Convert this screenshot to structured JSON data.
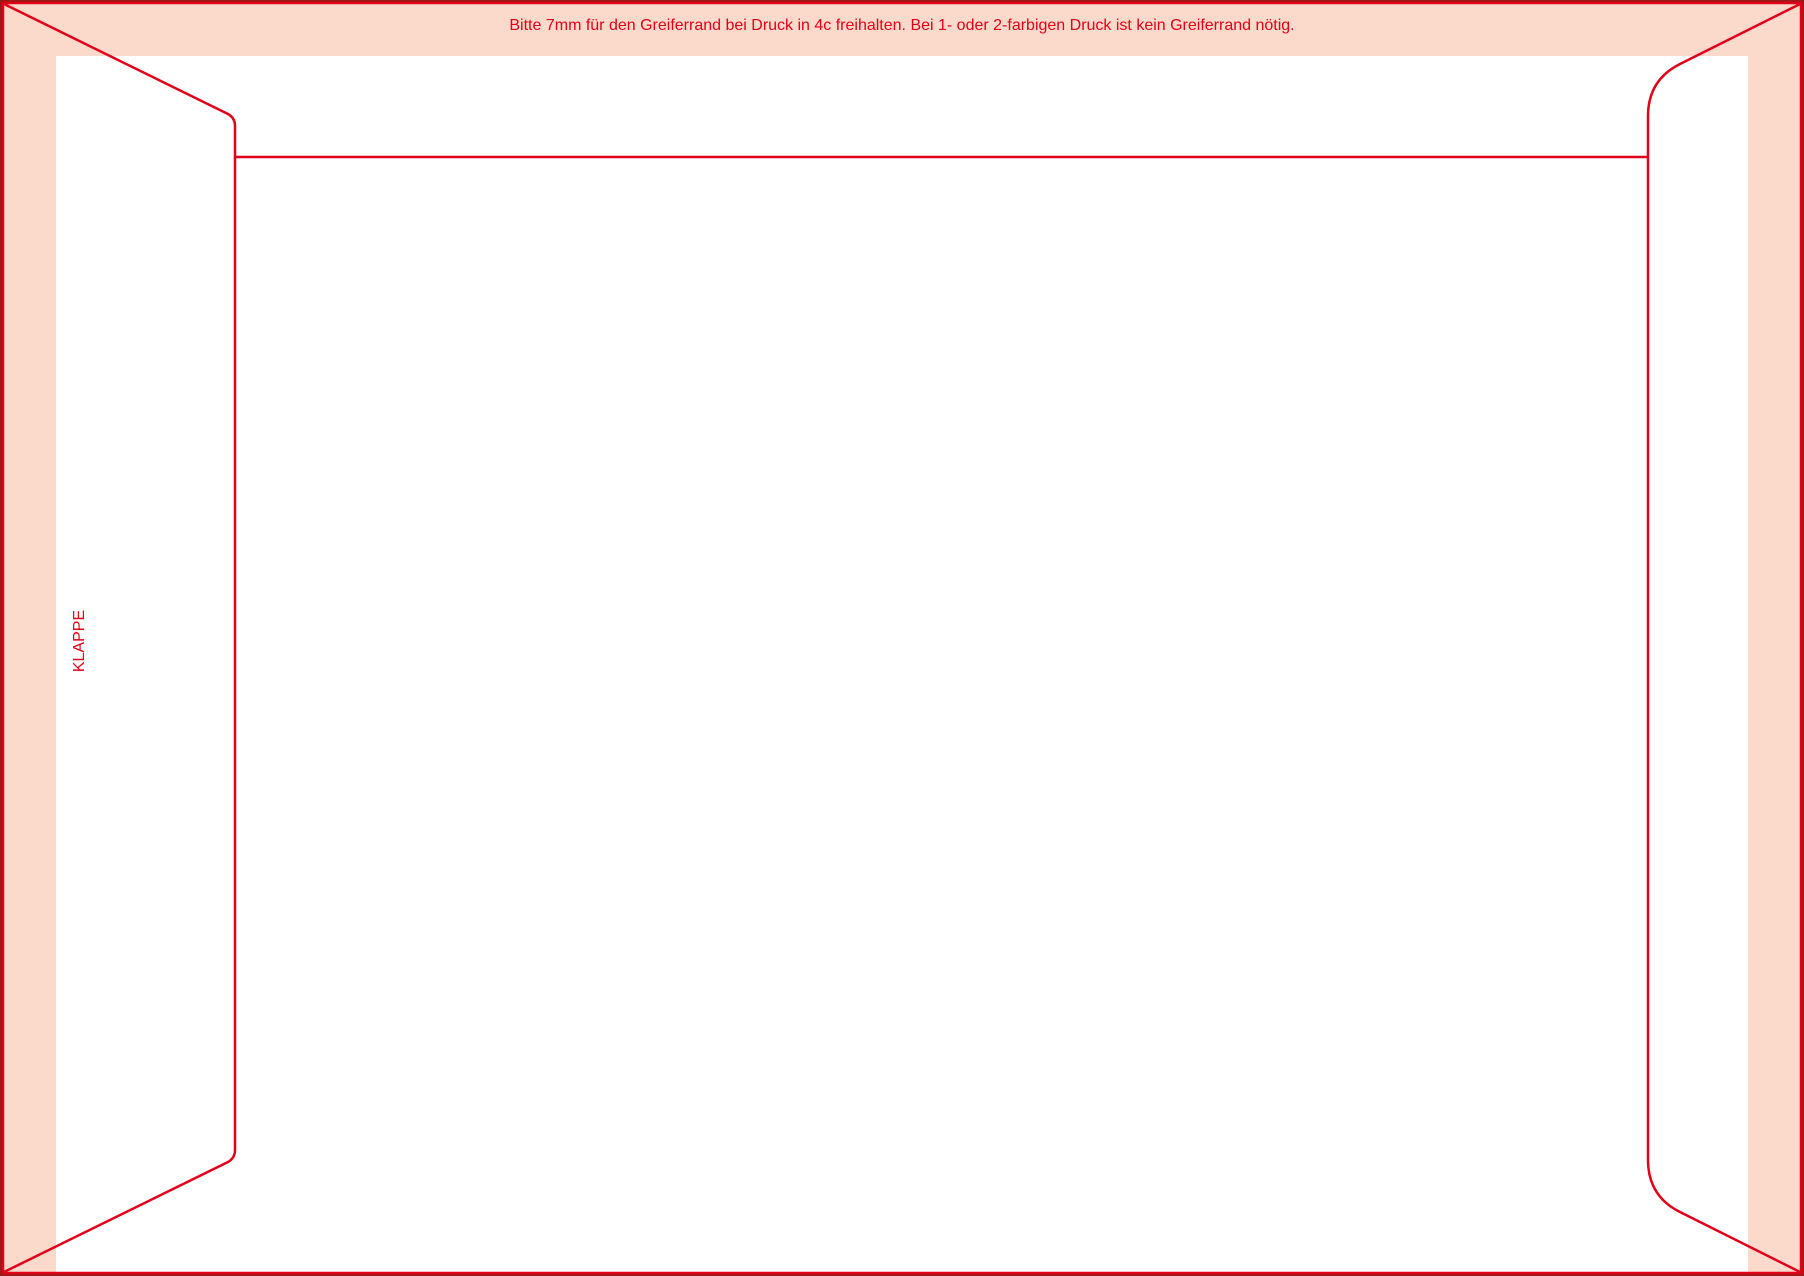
{
  "notice": {
    "text": "Bitte 7mm für den Greiferrand bei Druck in 4c freihalten. Bei 1- oder 2-farbigen Druck ist kein Greiferrand nötig."
  },
  "flap": {
    "label": "KLAPPE"
  },
  "colors": {
    "line": "#e1001a",
    "gripper_margin": "#fbdacb",
    "background": "#ffffff",
    "page_border": "#9a1a1a"
  }
}
